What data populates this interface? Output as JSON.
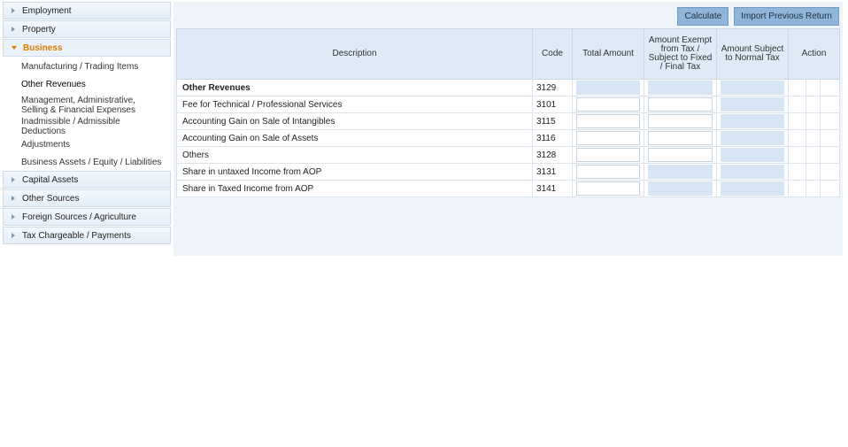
{
  "sidebar": {
    "top_sections": [
      "Employment",
      "Property"
    ],
    "open_section": "Business",
    "sub_items": [
      "Manufacturing / Trading Items",
      "Other Revenues",
      "Management, Administrative, Selling & Financial Expenses",
      "Inadmissible / Admissible Deductions",
      "Adjustments",
      "Business Assets / Equity / Liabilities"
    ],
    "bottom_sections": [
      "Capital Assets",
      "Other Sources",
      "Foreign Sources / Agriculture",
      "Tax Chargeable / Payments"
    ]
  },
  "toolbar": {
    "calculate": "Calculate",
    "import": "Import Previous Return"
  },
  "table": {
    "headers": {
      "description": "Description",
      "code": "Code",
      "total": "Total Amount",
      "exempt": "Amount Exempt from Tax / Subject to Fixed / Final Tax",
      "normal": "Amount Subject to Normal Tax",
      "action": "Action"
    },
    "rows": [
      {
        "desc": "Other Revenues",
        "code": "3129"
      },
      {
        "desc": "Fee for Technical / Professional Services",
        "code": "3101"
      },
      {
        "desc": "Accounting Gain on Sale of Intangibles",
        "code": "3115"
      },
      {
        "desc": "Accounting Gain on Sale of Assets",
        "code": "3116"
      },
      {
        "desc": "Others",
        "code": "3128"
      },
      {
        "desc": "Share in untaxed Income from AOP",
        "code": "3131"
      },
      {
        "desc": "Share in Taxed Income from AOP",
        "code": "3141"
      }
    ]
  },
  "colors": {
    "accent": "#e07b00",
    "button": "#8fb6d9",
    "disabled_field": "#d6e6f4"
  }
}
